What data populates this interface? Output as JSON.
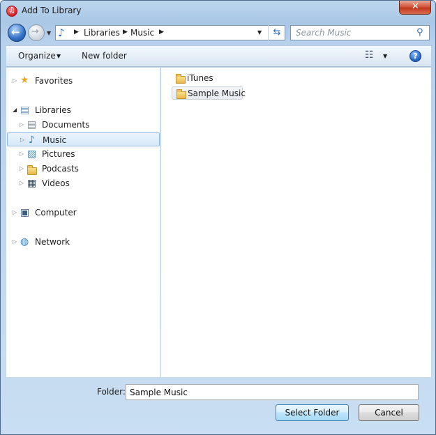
{
  "window": {
    "title": "Add To Library",
    "close_glyph": "✕"
  },
  "nav": {
    "back_glyph": "←",
    "forward_glyph": "→",
    "dropdown_glyph": "▼"
  },
  "address": {
    "crumbs": [
      "Libraries",
      "Music"
    ],
    "separator_glyph": "▶",
    "dropdown_glyph": "▼",
    "refresh_glyph": "⇆"
  },
  "search": {
    "placeholder": "Search Music",
    "icon_glyph": "⚲"
  },
  "toolbar": {
    "organize_label": "Organize",
    "organize_caret": "▼",
    "new_folder_label": "New folder",
    "views_glyph": "☷",
    "views_caret": "▼",
    "help_glyph": "?"
  },
  "tree": {
    "favorites": "Favorites",
    "libraries": "Libraries",
    "documents": "Documents",
    "music": "Music",
    "pictures": "Pictures",
    "podcasts": "Podcasts",
    "videos": "Videos",
    "computer": "Computer",
    "network": "Network",
    "collapsed_arrow": "▷",
    "expanded_arrow": "◢"
  },
  "icons": {
    "favorites": "★",
    "libraries": "▤",
    "documents": "▤",
    "music": "♪",
    "pictures": "▨",
    "videos": "▦",
    "computer": "▣",
    "network": "◍"
  },
  "files": {
    "items": [
      "iTunes",
      "Sample Music"
    ]
  },
  "footer": {
    "folder_label": "Folder:",
    "folder_value": "Sample Music",
    "select_button": "Select Folder",
    "cancel_button": "Cancel"
  },
  "colors": {
    "accent": "#2a75c9",
    "selection": "#d6e8fa",
    "close": "#c0391e"
  }
}
